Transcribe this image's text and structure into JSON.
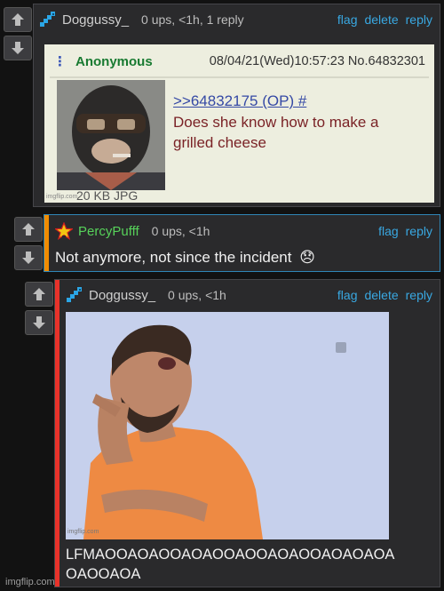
{
  "comments": [
    {
      "username": "Doggussy_",
      "meta": "0 ups, <1h, 1 reply",
      "actions": [
        "flag",
        "delete",
        "reply"
      ],
      "image": {
        "poster": "Anonymous",
        "datetime": "08/04/21(Wed)10:57:23 No.64832301",
        "reply_link": ">>64832175 (OP) #",
        "text_line1": "Does she know how to make a",
        "text_line2": "grilled cheese",
        "file_info": "20 KB JPG",
        "site": "imgflip.com"
      }
    },
    {
      "username": "PercyPufff",
      "meta": "0 ups, <1h",
      "actions": [
        "flag",
        "reply"
      ],
      "text": "Not anymore, not since the incident",
      "emoji": "😞"
    },
    {
      "username": "Doggussy_",
      "meta": "0 ups, <1h",
      "actions": [
        "flag",
        "delete",
        "reply"
      ],
      "image_site": "imgflip.com",
      "text_line1": "LFMAOOAOAOOAOAOOAOOAOAOOAOAOAOA",
      "text_line2": "OAOOAOA"
    }
  ],
  "footer": {
    "watermark": "imgflip.com"
  },
  "colors": {
    "link": "#39a8e2",
    "accent_orange": "#f08c00",
    "accent_red": "#e8322a",
    "green_user": "#57d25a",
    "highlight_border": "#2f86b7"
  },
  "icons": [
    "upvote-arrow-icon",
    "downvote-arrow-icon",
    "user-pixel-icon",
    "star-user-icon"
  ]
}
